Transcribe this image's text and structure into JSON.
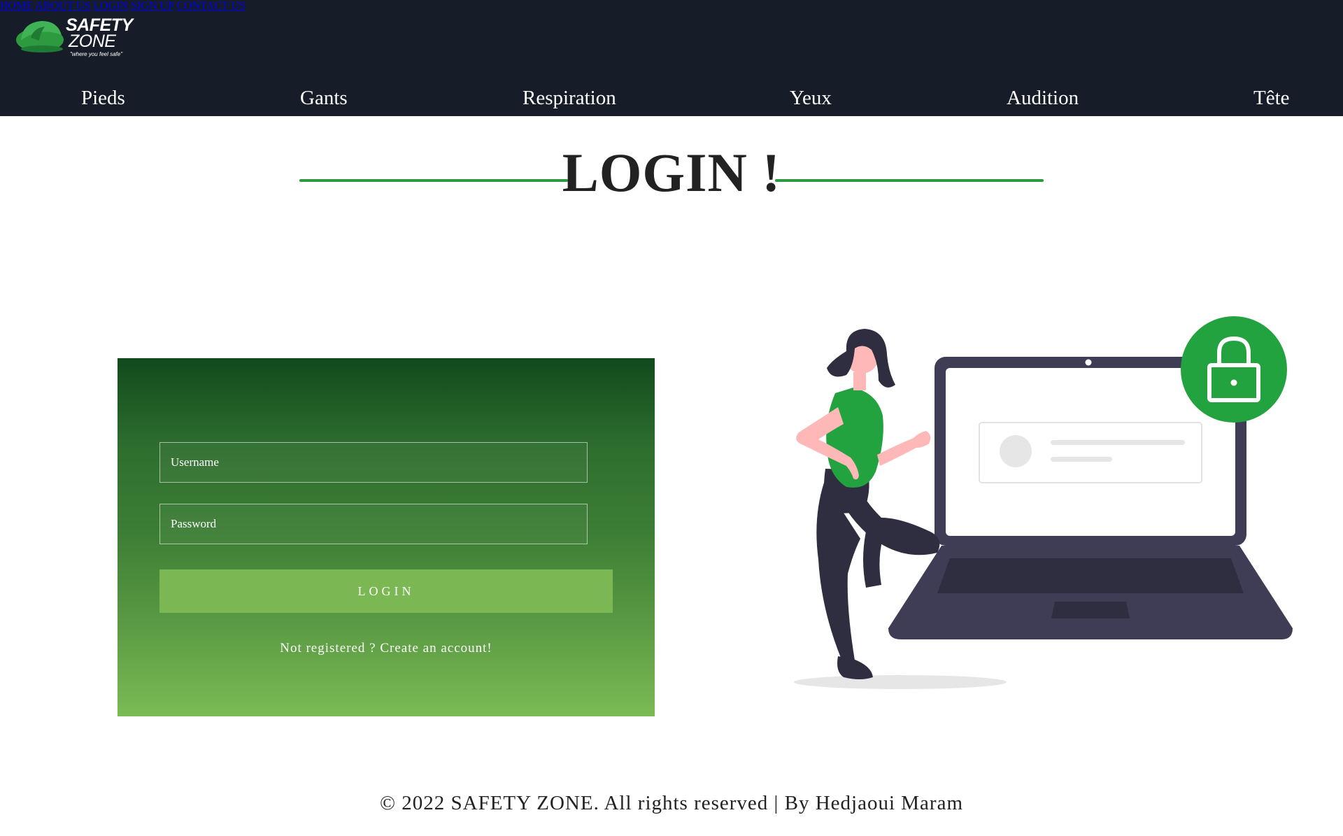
{
  "brand": {
    "line1": "SAFETY",
    "line2": "ZONE",
    "tagline": "\"where you feel safe\"",
    "color": "#2e9a3f"
  },
  "main_nav": {
    "items": [
      {
        "label": "HOME",
        "active": false
      },
      {
        "label": "ABOUT US",
        "active": false
      },
      {
        "label": "LOGIN",
        "active": true
      },
      {
        "label": "SIGN UP",
        "active": false
      },
      {
        "label": "CONTACT US",
        "active": false
      }
    ],
    "active_color": "#2ea043"
  },
  "sub_nav": {
    "items": [
      {
        "label": "Pieds"
      },
      {
        "label": "Gants"
      },
      {
        "label": "Respiration"
      },
      {
        "label": "Yeux"
      },
      {
        "label": "Audition"
      },
      {
        "label": "Tête"
      }
    ]
  },
  "page": {
    "heading": "LOGIN !"
  },
  "login_form": {
    "username_placeholder": "Username",
    "password_placeholder": "Password",
    "submit_label": "LOGIN",
    "register_text": "Not registered ? Create an account!"
  },
  "illustration": {
    "icon": "lock-icon",
    "accent": "#23a33f"
  },
  "footer": {
    "text": "© 2022 SAFETY ZONE. All rights reserved | By Hedjaoui Maram"
  }
}
